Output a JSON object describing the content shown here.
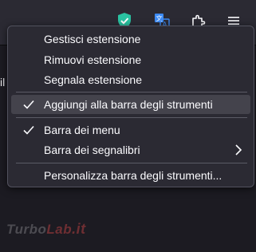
{
  "toolbar": {
    "icons": [
      "shield-extension-icon",
      "translate-extension-icon",
      "puzzle-extensions-icon",
      "hamburger-menu-icon"
    ]
  },
  "page": {
    "edge_text": "il"
  },
  "watermark": {
    "part1": "Turbo",
    "part2": "Lab",
    "part3": ".it"
  },
  "context_menu": {
    "items": [
      {
        "label": "Gestisci estensione",
        "checked": false,
        "submenu": false
      },
      {
        "label": "Rimuovi estensione",
        "checked": false,
        "submenu": false
      },
      {
        "label": "Segnala estensione",
        "checked": false,
        "submenu": false
      },
      {
        "label": "Aggiungi alla barra degli strumenti",
        "checked": true,
        "submenu": false,
        "highlighted": true
      },
      {
        "label": "Barra dei menu",
        "checked": true,
        "submenu": false
      },
      {
        "label": "Barra dei segnalibri",
        "checked": false,
        "submenu": true
      },
      {
        "label": "Personalizza barra degli strumenti...",
        "checked": false,
        "submenu": false
      }
    ]
  },
  "colors": {
    "menu_bg": "#2b2a33",
    "menu_hover": "#44434c",
    "shield_green": "#2ac3a2",
    "translate_blue": "#3d8bf5"
  }
}
